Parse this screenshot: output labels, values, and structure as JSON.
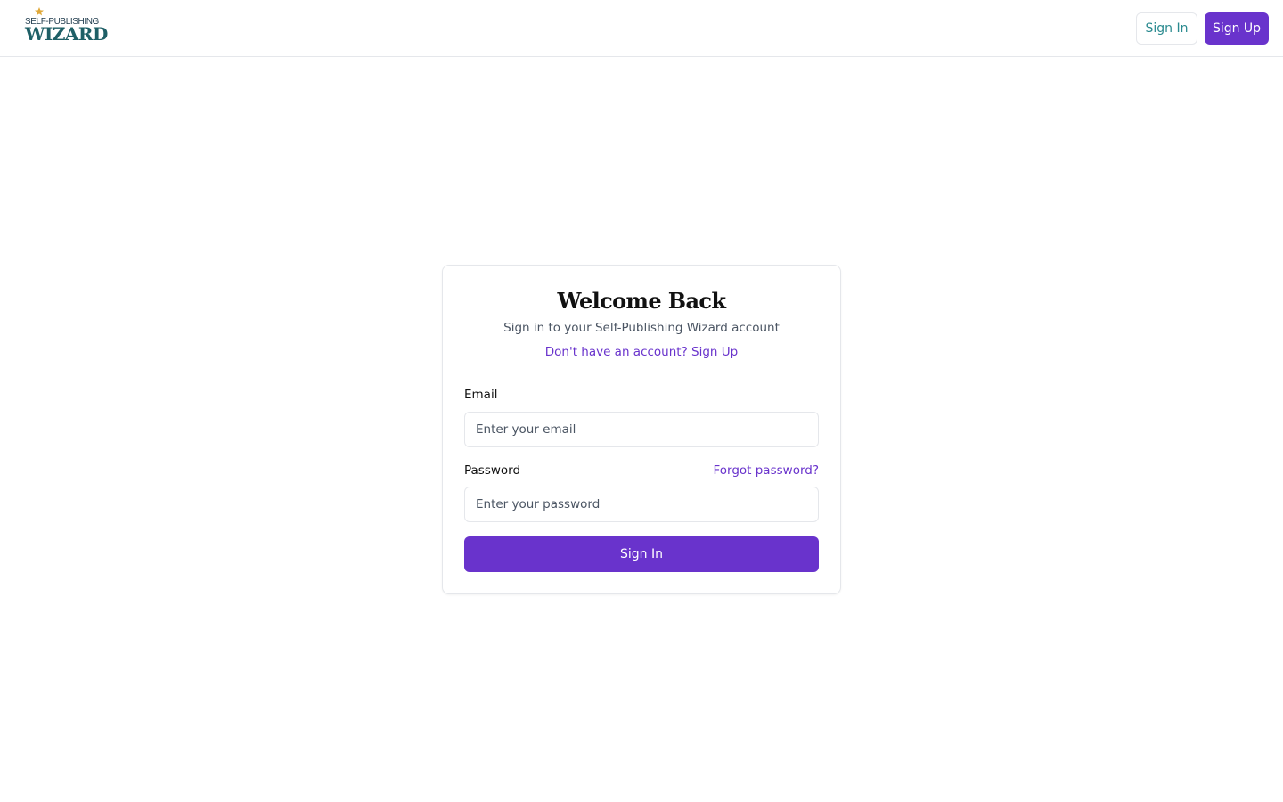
{
  "header": {
    "logo": {
      "top_text": "SELF-PUBLISHING",
      "main_text": "WIZARD",
      "icons": [
        "crescent-moon-icon",
        "star-icon"
      ]
    },
    "sign_in_label": "Sign In",
    "sign_up_label": "Sign Up"
  },
  "login_card": {
    "title": "Welcome Back",
    "subtitle": "Sign in to your Self-Publishing Wizard account",
    "signup_prompt": "Don't have an account? Sign Up",
    "email": {
      "label": "Email",
      "placeholder": "Enter your email",
      "value": ""
    },
    "password": {
      "label": "Password",
      "placeholder": "Enter your password",
      "value": "",
      "forgot_label": "Forgot password?"
    },
    "submit_label": "Sign In"
  },
  "colors": {
    "primary": "#6933cc",
    "teal": "#2a8a8f",
    "logo_teal": "#1e5f66",
    "logo_gold": "#e0a93a",
    "border": "#e5e7eb"
  }
}
